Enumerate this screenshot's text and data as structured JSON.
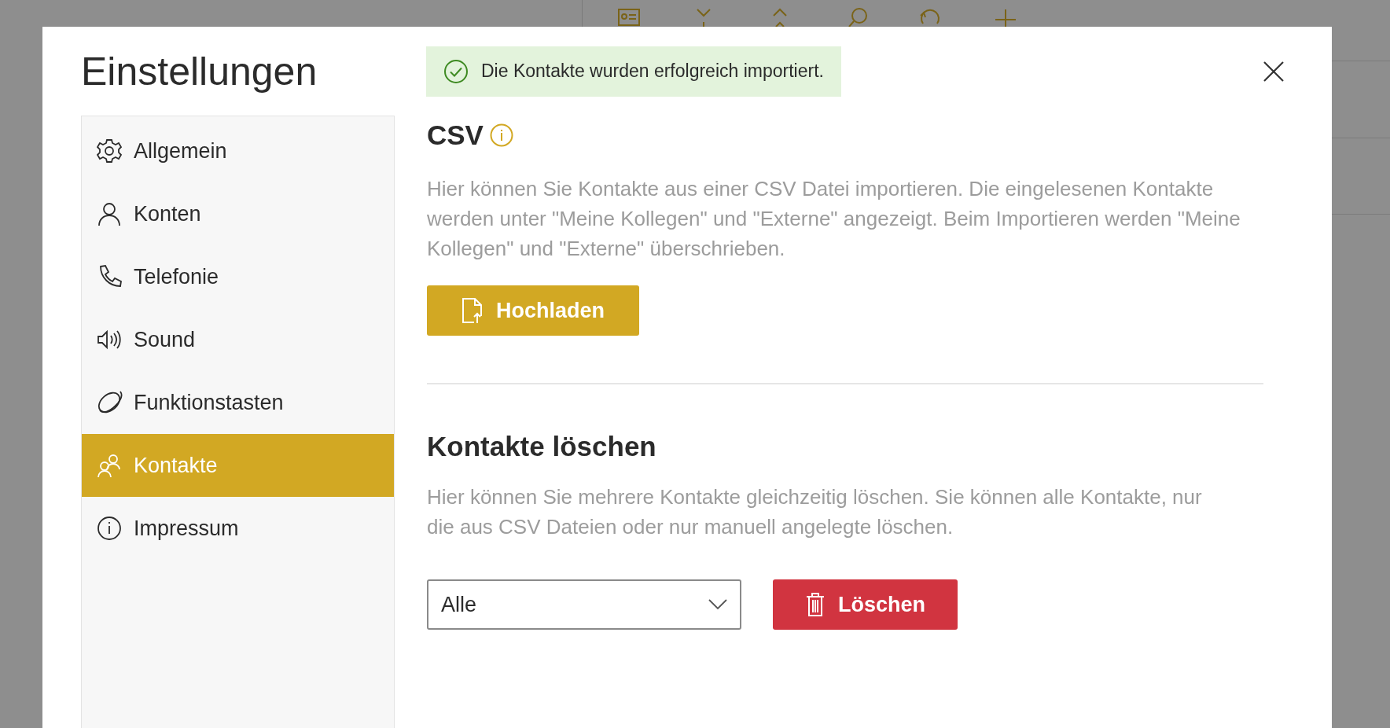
{
  "dialog": {
    "title": "Einstellungen"
  },
  "alert": {
    "text": "Die Kontakte wurden erfolgreich importiert."
  },
  "sidebar": {
    "items": [
      {
        "label": "Allgemein",
        "selected": false
      },
      {
        "label": "Konten",
        "selected": false
      },
      {
        "label": "Telefonie",
        "selected": false
      },
      {
        "label": "Sound",
        "selected": false
      },
      {
        "label": "Funktionstasten",
        "selected": false
      },
      {
        "label": "Kontakte",
        "selected": true
      },
      {
        "label": "Impressum",
        "selected": false
      }
    ]
  },
  "csv": {
    "heading": "CSV",
    "description": "Hier können Sie Kontakte aus einer CSV Datei importieren. Die eingelesenen Kontakte werden unter \"Meine Kollegen\" und \"Externe\" angezeigt. Beim Importieren werden \"Meine Kollegen\" und \"Externe\" überschrieben.",
    "button": "Hochladen"
  },
  "delete": {
    "heading": "Kontakte löschen",
    "description": "Hier können Sie mehrere Kontakte gleichzeitig löschen. Sie können alle Kontakte, nur die aus CSV Dateien oder nur manuell angelegte löschen.",
    "select": {
      "value": "Alle"
    },
    "button": "Löschen"
  }
}
